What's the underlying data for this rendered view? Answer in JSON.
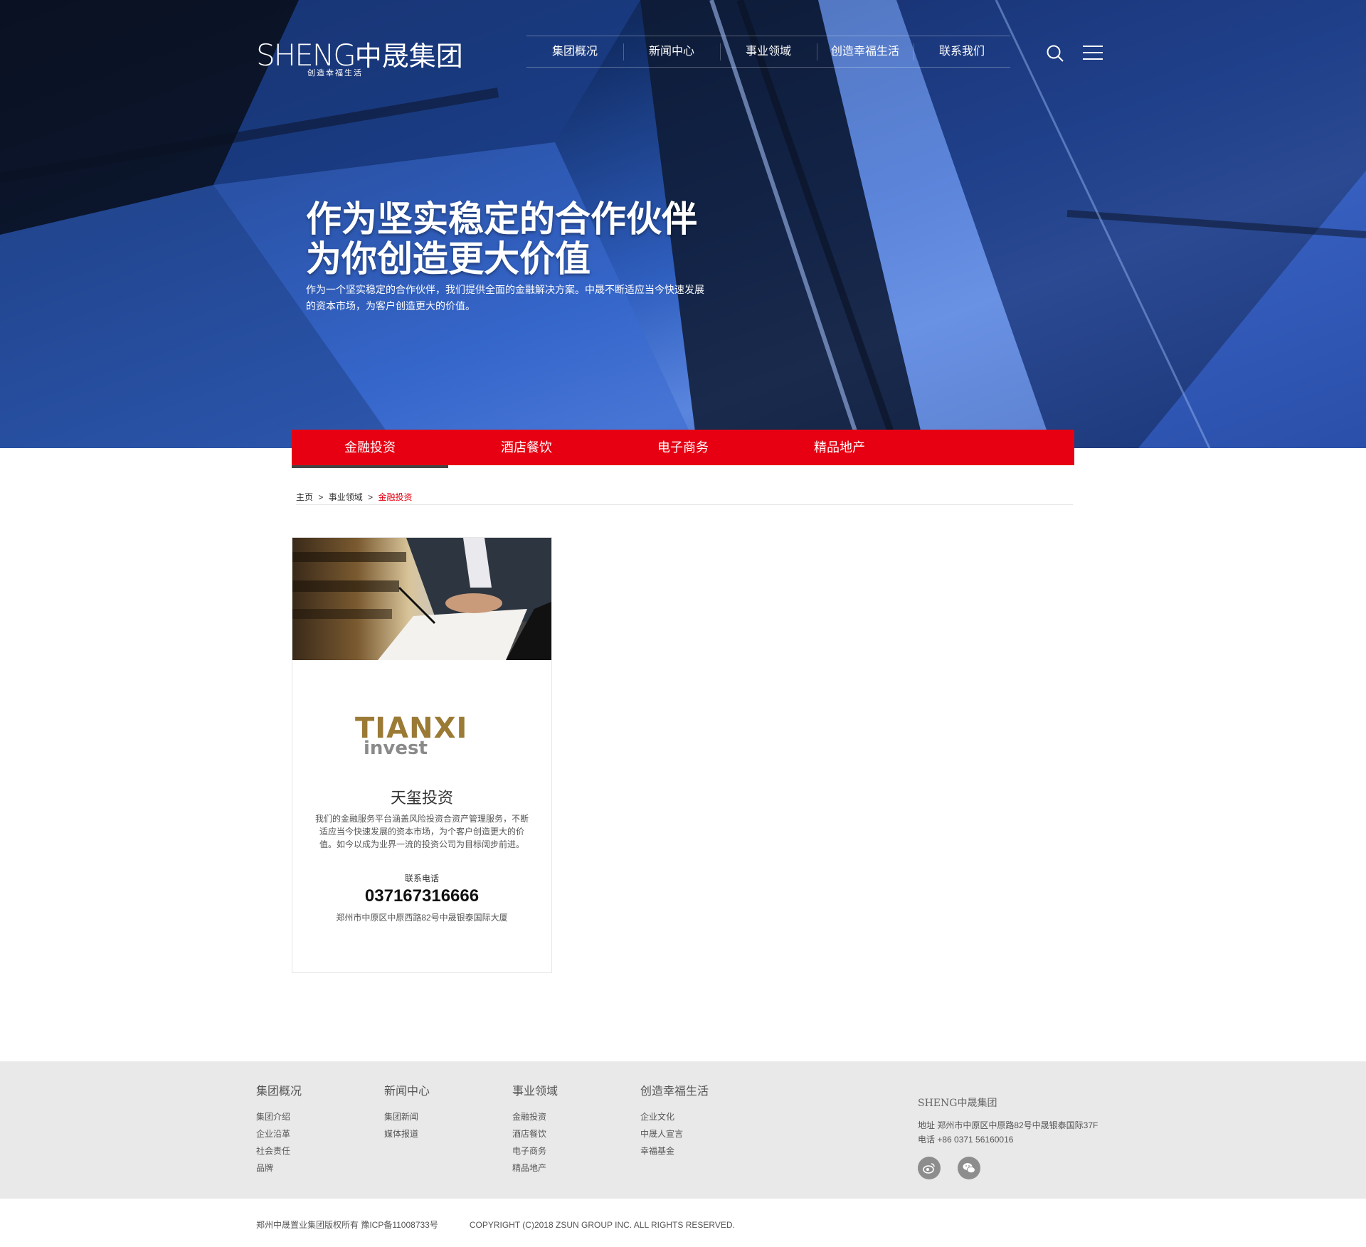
{
  "header": {
    "logo_en": "SHENG",
    "logo_cn": "中晟集团",
    "logo_sub": "创造幸福生活",
    "nav": [
      "集团概况",
      "新闻中心",
      "事业领域",
      "创造幸福生活",
      "联系我们"
    ]
  },
  "hero": {
    "title_line1": "作为坚实稳定的合作伙伴",
    "title_line2": "为你创造更大价值",
    "desc": "作为一个坚实稳定的合作伙伴，我们提供全面的金融解决方案。中晟不断适应当今快速发展的资本市场，为客户创造更大的价值。"
  },
  "subnav": {
    "tabs": [
      "金融投资",
      "酒店餐饮",
      "电子商务",
      "精品地产"
    ],
    "active": "金融投资"
  },
  "breadcrumb": {
    "home": "主页",
    "sep": ">",
    "section": "事业领域",
    "current": "金融投资"
  },
  "card": {
    "logo_top": "TIANXI",
    "logo_bottom": "invest",
    "name": "天玺投资",
    "desc": "我们的金融服务平台涵盖风险投资合资产管理服务，不断适应当今快速发展的资本市场，为个客户创造更大的价值。如今以成为业界一流的投资公司为目标阔步前进。",
    "phone_label": "联系电话",
    "phone": "037167316666",
    "address": "郑州市中原区中原西路82号中晟银泰国际大厦"
  },
  "footer": {
    "columns": [
      {
        "heading": "集团概况",
        "links": [
          "集团介绍",
          "企业沿革",
          "社会责任",
          "品牌"
        ]
      },
      {
        "heading": "新闻中心",
        "links": [
          "集团新闻",
          "媒体报道"
        ]
      },
      {
        "heading": "事业领域",
        "links": [
          "金融投资",
          "酒店餐饮",
          "电子商务",
          "精品地产"
        ]
      },
      {
        "heading": "创造幸福生活",
        "links": [
          "企业文化",
          "中晟人宣言",
          "幸福基金"
        ]
      }
    ],
    "info_logo": "SHENG中晟集团",
    "address": "地址  郑州市中原区中原路82号中晟银泰国际37F",
    "phone": "电话  +86 0371 56160016",
    "copyright_cn": "郑州中晟置业集团版权所有 豫ICP备11008733号",
    "copyright_en": "COPYRIGHT (C)2018 ZSUN GROUP INC. ALL RIGHTS RESERVED."
  }
}
